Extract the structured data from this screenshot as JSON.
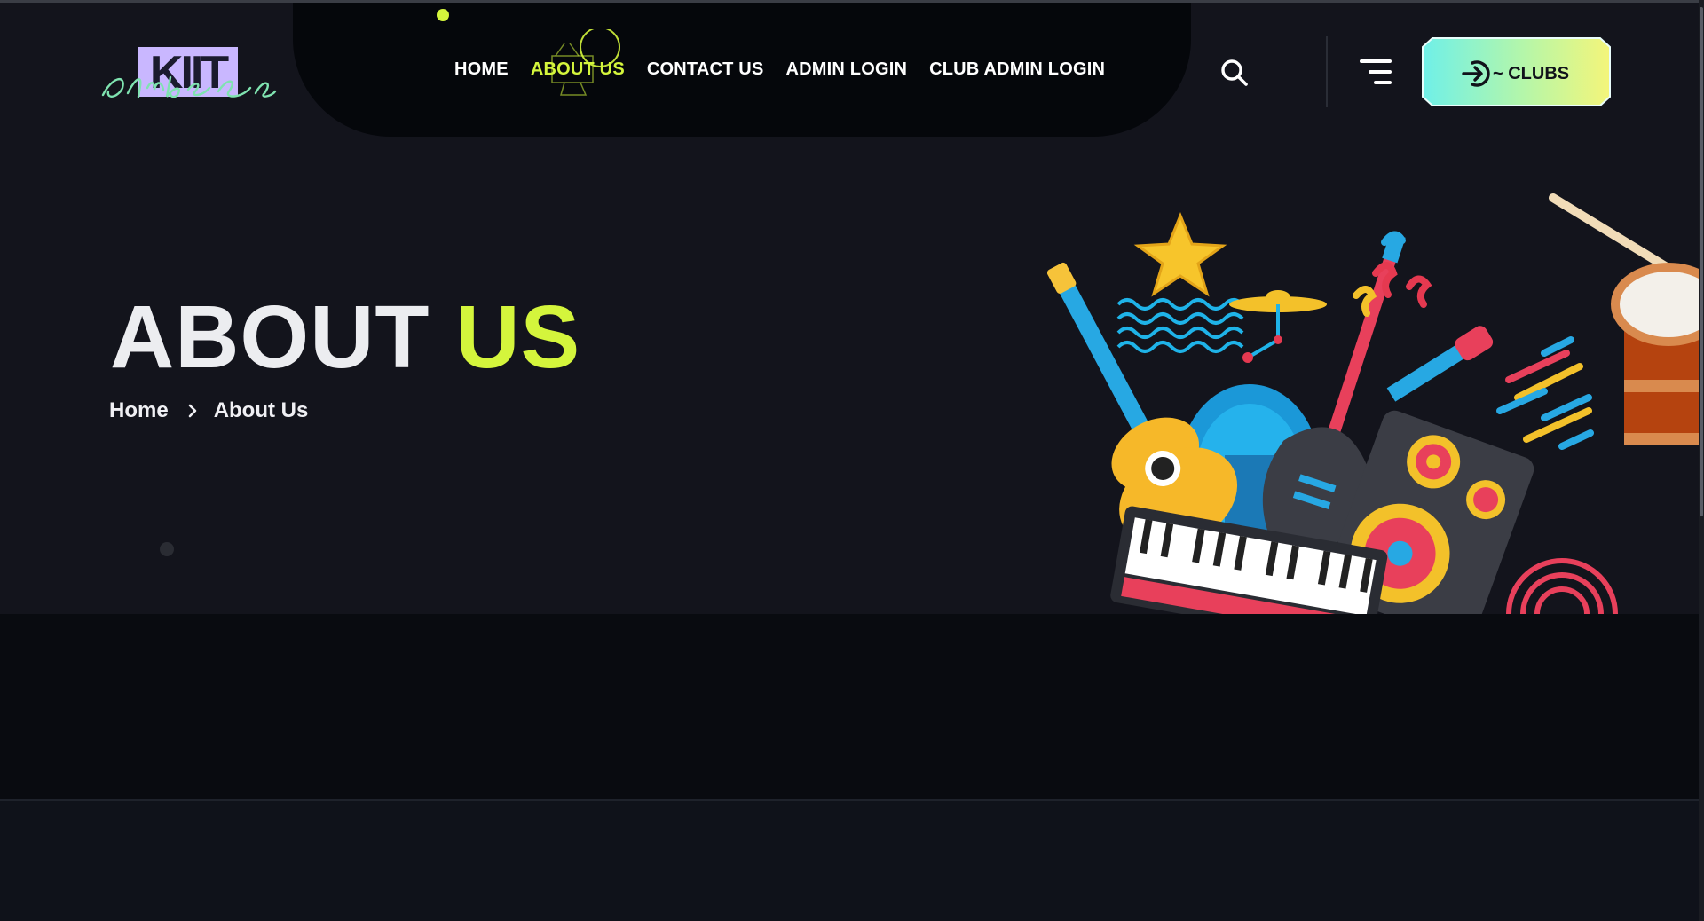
{
  "logo": {
    "text": "KIIT",
    "script": "clubs",
    "alt": "KIIT Clubs logo"
  },
  "nav": {
    "items": [
      {
        "label": "HOME",
        "active": false
      },
      {
        "label": "ABOUT US",
        "active": true
      },
      {
        "label": "CONTACT US",
        "active": false
      },
      {
        "label": "ADMIN LOGIN",
        "active": false
      },
      {
        "label": "CLUB ADMIN LOGIN",
        "active": false
      }
    ]
  },
  "header": {
    "search_icon": "search-icon",
    "menu_icon": "hamburger-menu-icon",
    "cta": {
      "label": "~ CLUBS",
      "icon": "login-icon"
    }
  },
  "hero": {
    "title_part1": "ABOUT",
    "title_part2": "US",
    "breadcrumb": [
      "Home",
      "About Us"
    ]
  },
  "colors": {
    "accent": "#d4f53c",
    "background": "#13141c",
    "nav_pill": "#05070b",
    "band": "#090b10"
  }
}
